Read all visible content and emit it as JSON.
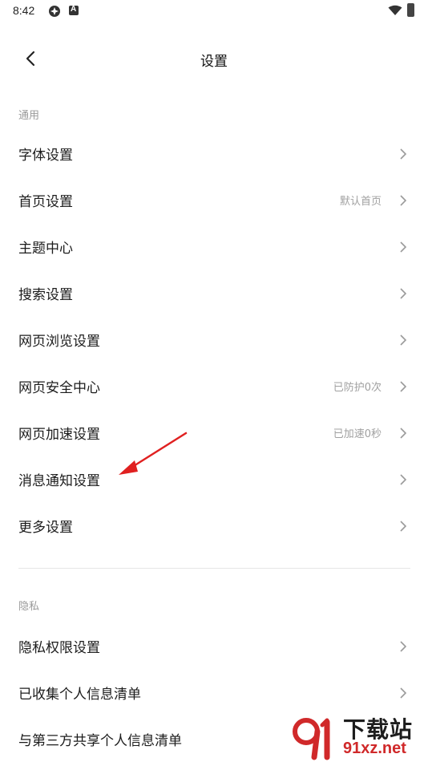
{
  "status_bar": {
    "time": "8:42"
  },
  "header": {
    "title": "设置"
  },
  "sections": {
    "general": {
      "label": "通用",
      "items": [
        {
          "label": "字体设置",
          "value": ""
        },
        {
          "label": "首页设置",
          "value": "默认首页"
        },
        {
          "label": "主题中心",
          "value": ""
        },
        {
          "label": "搜索设置",
          "value": ""
        },
        {
          "label": "网页浏览设置",
          "value": ""
        },
        {
          "label": "网页安全中心",
          "value": "已防护0次"
        },
        {
          "label": "网页加速设置",
          "value": "已加速0秒"
        },
        {
          "label": "消息通知设置",
          "value": ""
        },
        {
          "label": "更多设置",
          "value": ""
        }
      ]
    },
    "privacy": {
      "label": "隐私",
      "items": [
        {
          "label": "隐私权限设置",
          "value": ""
        },
        {
          "label": "已收集个人信息清单",
          "value": ""
        },
        {
          "label": "与第三方共享个人信息清单",
          "value": ""
        }
      ]
    }
  },
  "annotation": {
    "color": "#e02020"
  },
  "watermark": {
    "title": "下载站",
    "url": "91xz.net"
  }
}
